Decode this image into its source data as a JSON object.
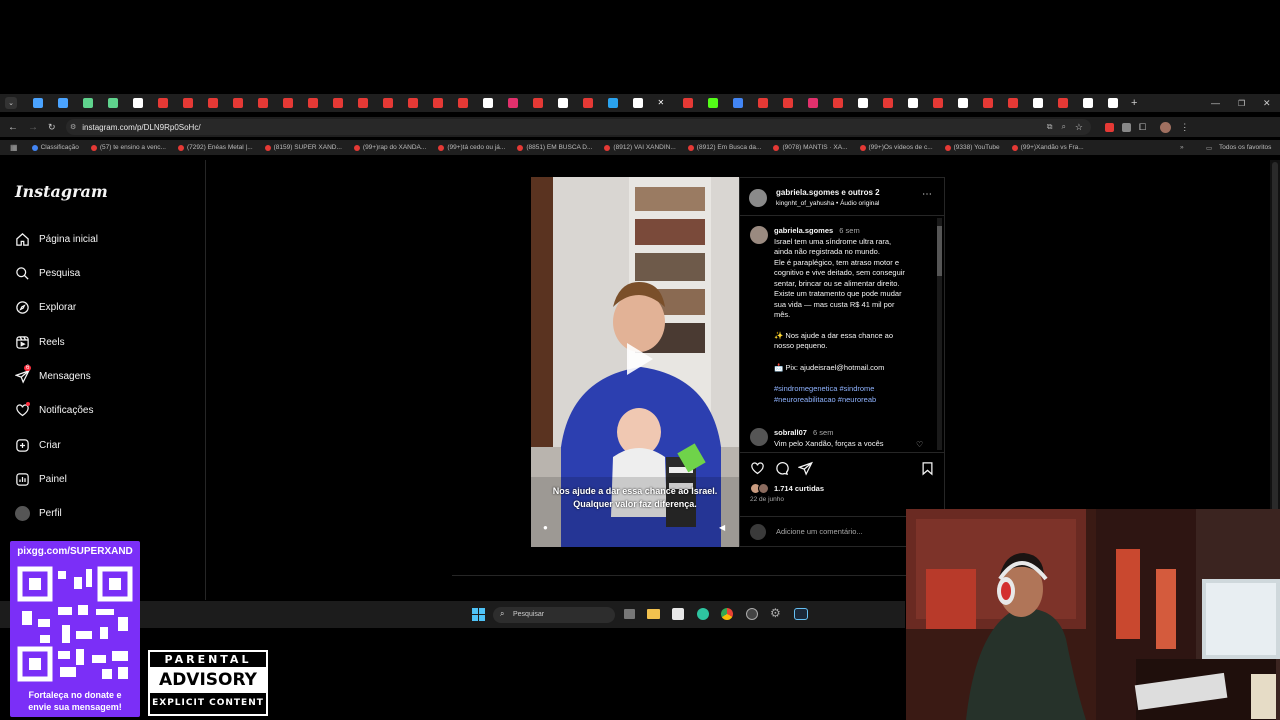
{
  "browser": {
    "url": "instagram.com/p/DLN9Rp0SoHc/",
    "tab_favicon_colors": [
      "#4aa3ff",
      "#4aa3ff",
      "#5fd38d",
      "#5fd38d",
      "#fff",
      "#e53935",
      "#e53935",
      "#e53935",
      "#e53935",
      "#e53935",
      "#e53935",
      "#e53935",
      "#e53935",
      "#e53935",
      "#e53935",
      "#e53935",
      "#e53935",
      "#e53935",
      "#fff",
      "#e1306c",
      "#e53935",
      "#fff",
      "#e53935",
      "#2aa3ef",
      "#fff",
      "#fff",
      "#e53935",
      "#53fc18",
      "#4285f4",
      "#e53935",
      "#e53935",
      "#e1306c",
      "#e53935",
      "#fff",
      "#e53935",
      "#fff",
      "#e53935",
      "#fff",
      "#e53935",
      "#e53935",
      "#fff",
      "#e53935",
      "#fff",
      "#fff"
    ],
    "new_tab_label": "+",
    "bookmarks": [
      {
        "label": "Classificação"
      },
      {
        "label": "(57) te ensino a venc..."
      },
      {
        "label": "(7292) Enéas Metal |..."
      },
      {
        "label": "(8159) SUPER XAND..."
      },
      {
        "label": "(99+)rap do XANDÃ..."
      },
      {
        "label": "(99+)tá cedo ou já..."
      },
      {
        "label": "(8851) EM BUSCA D..."
      },
      {
        "label": "(8912) VAI XANDIN..."
      },
      {
        "label": "(8912) Em Busca da..."
      },
      {
        "label": "(9078) MANTIS · XA..."
      },
      {
        "label": "(99+)Os vídeos de c..."
      },
      {
        "label": "(9338) YouTube"
      },
      {
        "label": "(99+)Xandão vs Fra..."
      }
    ],
    "all_bookmarks": "Todos os favoritos"
  },
  "sidebar": {
    "logo": "Instagram",
    "items": [
      {
        "label": "Página inicial"
      },
      {
        "label": "Pesquisa"
      },
      {
        "label": "Explorar"
      },
      {
        "label": "Reels"
      },
      {
        "label": "Mensagens",
        "badge": "6"
      },
      {
        "label": "Notificações"
      },
      {
        "label": "Criar"
      },
      {
        "label": "Painel"
      },
      {
        "label": "Perfil"
      }
    ]
  },
  "post": {
    "author_line": "gabriela.sgomes e outros 2",
    "audio_line": "kingnht_of_yahusha • Áudio original",
    "caption_user": "gabriela.sgomes",
    "caption_time": "6 sem",
    "caption_lines": [
      "Israel tem uma síndrome ultra rara,",
      "ainda não registrada no mundo.",
      "Ele é paraplégico, tem atraso motor e",
      "cognitivo e vive deitado, sem conseguir",
      "sentar, brincar ou se alimentar direito.",
      "Existe um tratamento que pode mudar",
      "sua vida — mas custa R$ 41 mil por",
      "mês."
    ],
    "caption_help_1": "✨ Nos ajude a dar essa chance ao",
    "caption_help_2": "nosso pequeno.",
    "caption_pix": "📩 Pix: ajudeisrael@hotmail.com",
    "hashtags_1": "#sindromegenetica #sindrome",
    "hashtags_2": "#neuroreabilitacao #neuroreab",
    "comment_user": "sobrall07",
    "comment_time": "6 sem",
    "comment_text": "Vim pelo Xandão, forças a vocês",
    "likes": "1.714 curtidas",
    "date": "22 de junho",
    "comment_placeholder": "Adicione um comentário...",
    "video_subtitle_1": "Nos ajude a dar essa chance ao Israel.",
    "video_subtitle_2": "Qualquer valor faz diferença."
  },
  "taskbar": {
    "search_label": "Pesquisar"
  },
  "overlay": {
    "pix_url": "pixgg.com/SUPERXAND",
    "pix_msg_1": "Fortaleça no donate e",
    "pix_msg_2": "envie sua mensagem!",
    "advisory_1": "PARENTAL",
    "advisory_2": "ADVISORY",
    "advisory_3": "EXPLICIT CONTENT"
  }
}
